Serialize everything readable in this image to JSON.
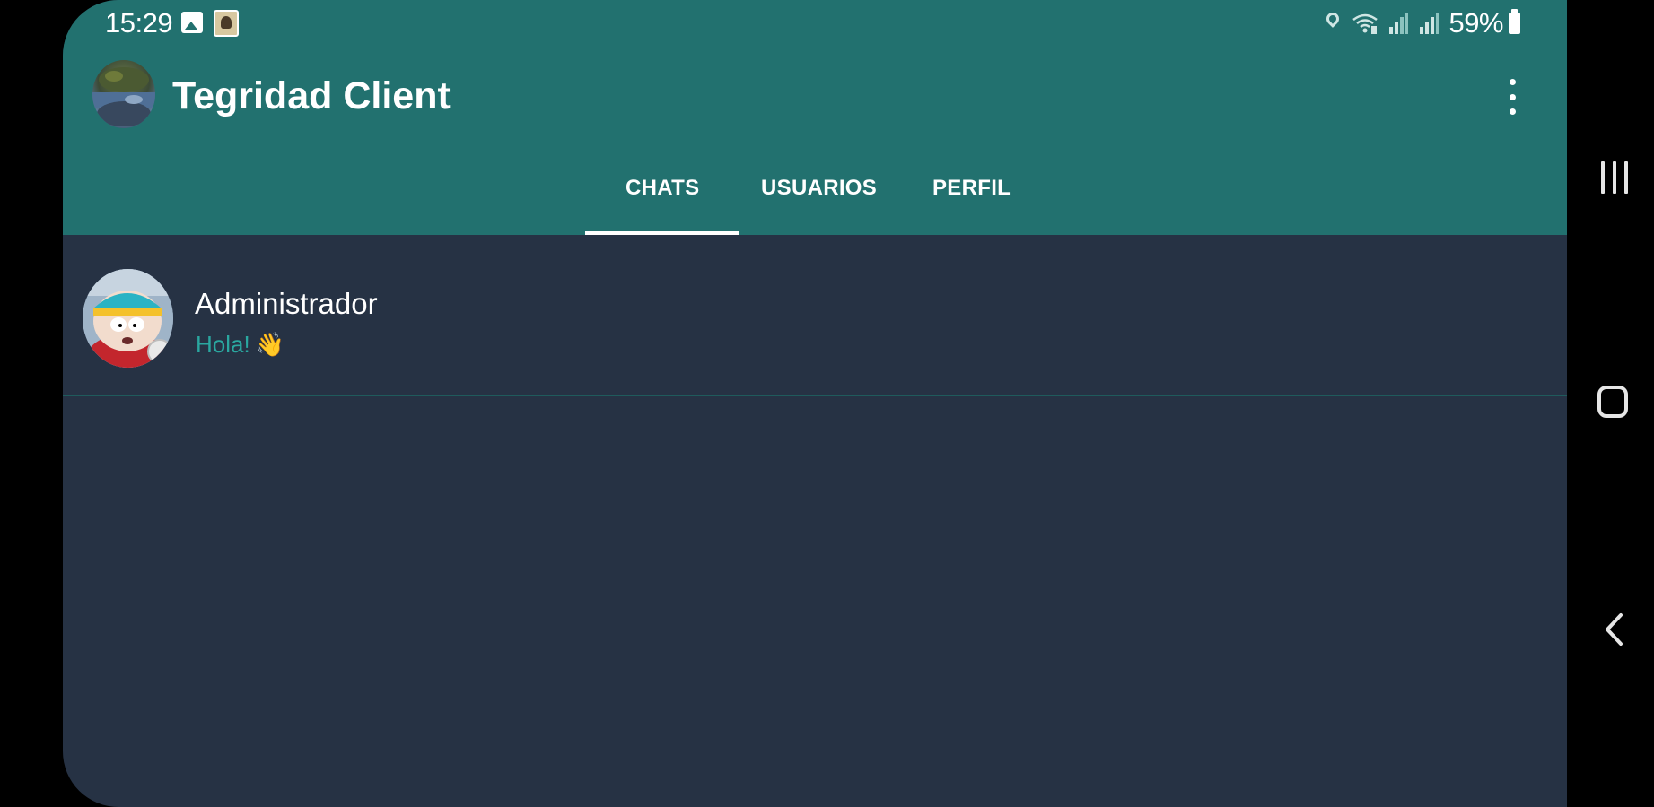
{
  "status_bar": {
    "time": "15:29",
    "battery": "59%",
    "icons": [
      "gallery-icon",
      "app-thumbnail-icon",
      "location-icon",
      "wifi-icon",
      "signal-icon",
      "signal-icon",
      "battery-icon"
    ]
  },
  "toolbar": {
    "title": "Tegridad Client",
    "avatar_icon": "profile-avatar",
    "menu_icon": "more-vert-icon"
  },
  "tabs": [
    {
      "label": "CHATS",
      "selected": true
    },
    {
      "label": "USUARIOS",
      "selected": false
    },
    {
      "label": "PERFIL",
      "selected": false
    }
  ],
  "chats": [
    {
      "name": "Administrador",
      "last_message": "Hola!",
      "emoji": "👋",
      "avatar_icon": "cartman-avatar"
    }
  ],
  "nav_bar": {
    "icons": [
      "recents-icon",
      "home-icon",
      "back-icon"
    ]
  },
  "colors": {
    "primary": "#22716f",
    "background": "#263244",
    "accent_text": "#2aa7a0",
    "divider": "#1f5b5c"
  }
}
